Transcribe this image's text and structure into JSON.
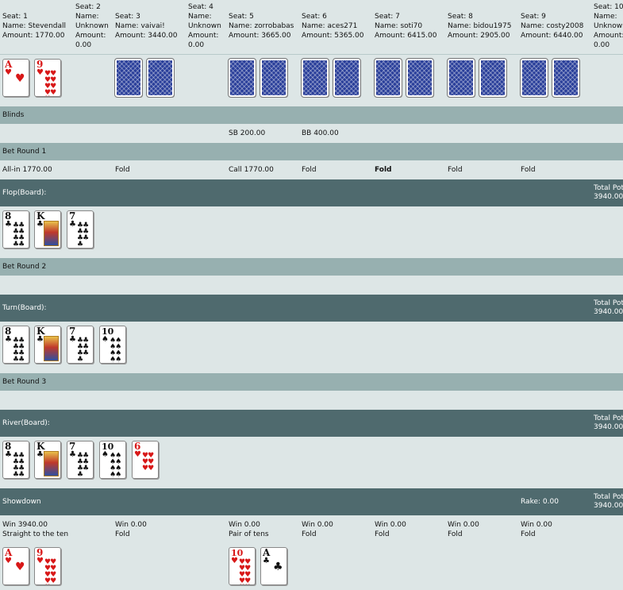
{
  "seats": [
    {
      "seat": "Seat: 1",
      "name": "Name: Stevendall",
      "amount": "Amount: 1770.00"
    },
    {
      "seat": "Seat: 2",
      "name": "Name:",
      "name2": "Unknown",
      "amount": "Amount:",
      "amount2": "0.00"
    },
    {
      "seat": "Seat: 3",
      "name": "Name: vaivai!",
      "amount": "Amount: 3440.00"
    },
    {
      "seat": "Seat: 4",
      "name": "Name:",
      "name2": "Unknown",
      "amount": "Amount:",
      "amount2": "0.00"
    },
    {
      "seat": "Seat: 5",
      "name": "Name: zorrobabas",
      "amount": "Amount: 3665.00"
    },
    {
      "seat": "Seat: 6",
      "name": "Name: aces271",
      "amount": "Amount: 5365.00"
    },
    {
      "seat": "Seat: 7",
      "name": "Name: soti70",
      "amount": "Amount: 6415.00"
    },
    {
      "seat": "Seat: 8",
      "name": "Name: bidou1975",
      "amount": "Amount: 2905.00"
    },
    {
      "seat": "Seat: 9",
      "name": "Name: costy2008",
      "amount": "Amount: 6440.00"
    },
    {
      "seat": "Seat: 10",
      "name": "Name:",
      "name2": "Unknown",
      "amount": "Amount:",
      "amount2": "0.00"
    }
  ],
  "hero_cards": [
    {
      "rank": "A",
      "suit": "♥",
      "color": "red"
    },
    {
      "rank": "9",
      "suit": "♥",
      "color": "red"
    }
  ],
  "sections": {
    "blinds": "Blinds",
    "bet_round_1": "Bet Round 1",
    "flop": "Flop(Board):",
    "bet_round_2": "Bet Round 2",
    "turn": "Turn(Board):",
    "bet_round_3": "Bet Round 3",
    "river": "River(Board):",
    "showdown": "Showdown"
  },
  "blinds": {
    "sb": "SB 200.00",
    "bb": "BB 400.00"
  },
  "bet_round_1_actions": [
    {
      "text": "All-in 1770.00",
      "bold": false
    },
    {
      "text": "Fold",
      "bold": false
    },
    {
      "text": "Call 1770.00",
      "bold": false
    },
    {
      "text": "Fold",
      "bold": false
    },
    {
      "text": "Fold",
      "bold": true
    },
    {
      "text": "Fold",
      "bold": false
    },
    {
      "text": "Fold",
      "bold": false
    }
  ],
  "pot": {
    "label": "Total Pot",
    "value": "3940.00"
  },
  "board": [
    {
      "rank": "8",
      "suit": "♣",
      "color": "black",
      "face": false
    },
    {
      "rank": "K",
      "suit": "♣",
      "color": "black",
      "face": true
    },
    {
      "rank": "7",
      "suit": "♣",
      "color": "black",
      "face": false
    },
    {
      "rank": "10",
      "suit": "♠",
      "color": "black",
      "face": false
    },
    {
      "rank": "6",
      "suit": "♥",
      "color": "red",
      "face": false
    }
  ],
  "rake": "Rake: 0.00",
  "showdown_results": [
    {
      "win": "Win 3940.00",
      "desc": "Straight to the ten"
    },
    {
      "win": "Win 0.00",
      "desc": "Fold"
    },
    {
      "win": "Win 0.00",
      "desc": "Pair of tens"
    },
    {
      "win": "Win 0.00",
      "desc": "Fold"
    },
    {
      "win": "Win 0.00",
      "desc": "Fold"
    },
    {
      "win": "Win 0.00",
      "desc": "Fold"
    },
    {
      "win": "Win 0.00",
      "desc": "Fold"
    }
  ],
  "showdown_cards": {
    "seat1": [
      {
        "rank": "A",
        "suit": "♥",
        "color": "red"
      },
      {
        "rank": "9",
        "suit": "♥",
        "color": "red"
      }
    ],
    "seat5": [
      {
        "rank": "10",
        "suit": "♥",
        "color": "red"
      },
      {
        "rank": "A",
        "suit": "♣",
        "color": "black"
      }
    ]
  }
}
